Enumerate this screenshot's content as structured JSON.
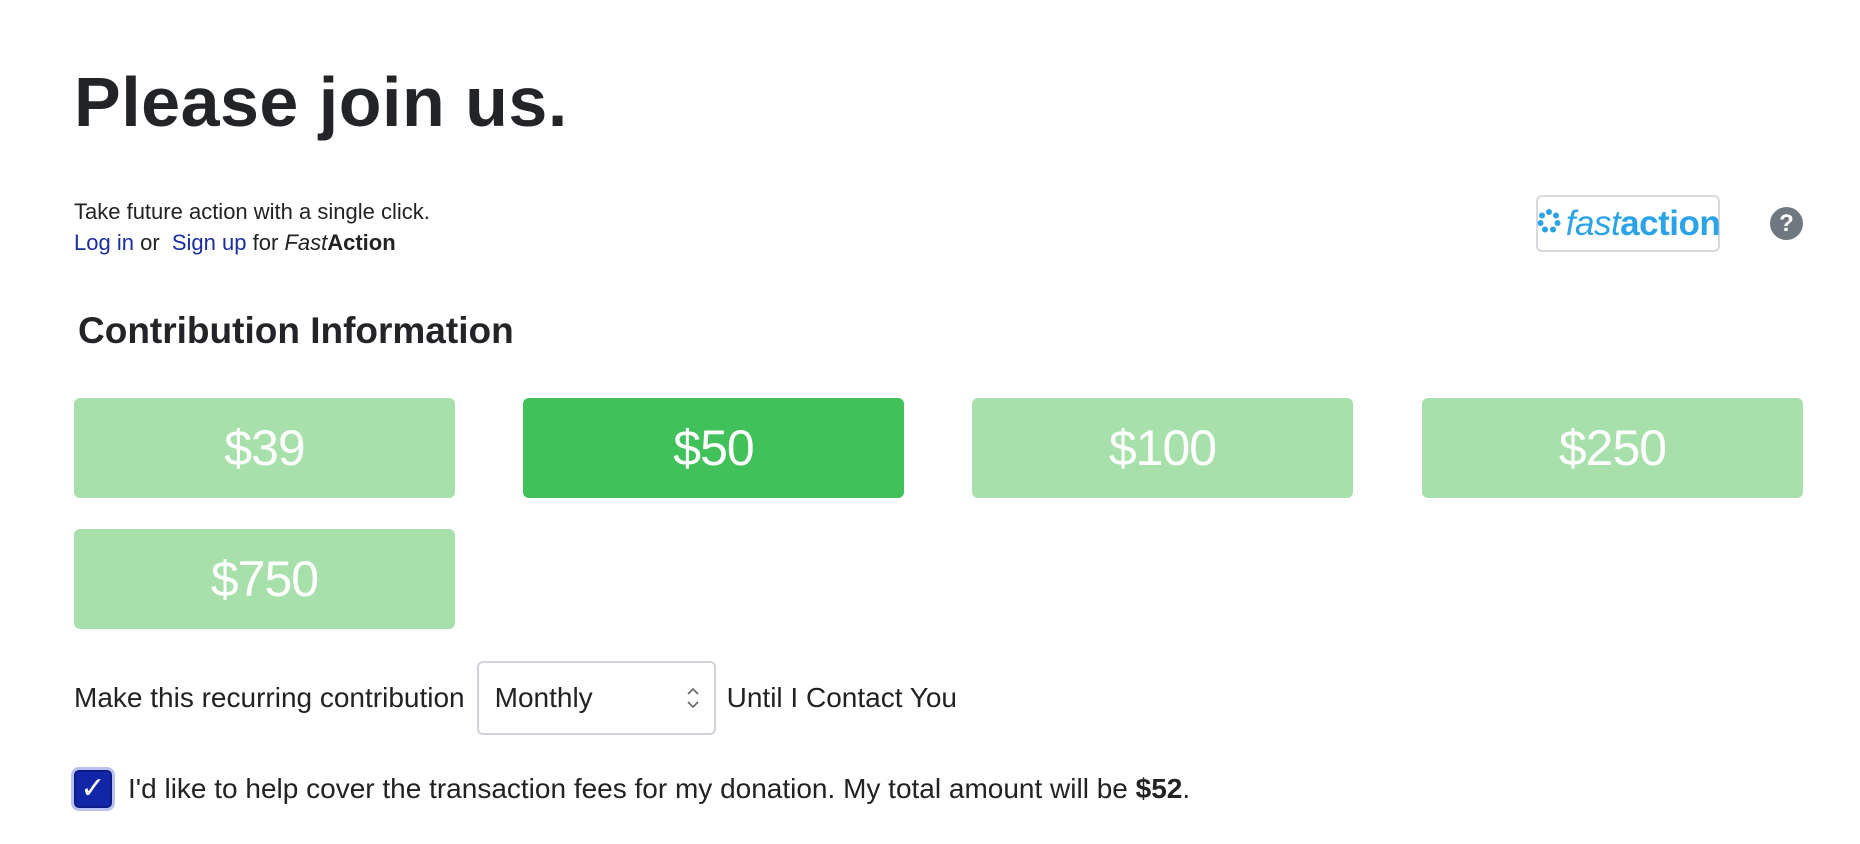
{
  "header": {
    "title": "Please join us."
  },
  "fastaction": {
    "tagline": "Take future action with a single click.",
    "login_link": "Log in",
    "or_text": "or",
    "signup_link": "Sign up",
    "for_text": "for",
    "brand_fast": "Fast",
    "brand_action": "Action",
    "logo_fast": "fast",
    "logo_action": "action",
    "help_label": "?"
  },
  "contribution": {
    "heading": "Contribution Information",
    "amounts": [
      "$39",
      "$50",
      "$100",
      "$250",
      "$750"
    ],
    "selected_amount": "$50",
    "recurring_label": "Make this recurring contribution",
    "frequency_value": "Monthly",
    "until_label": "Until I Contact You",
    "fees_text": "I'd like to help cover the transaction fees for my donation. My total amount will be",
    "fees_total": "$52",
    "fees_period": ".",
    "fees_checked": true
  },
  "colors": {
    "selected_amount_bg": "#41c15a",
    "amount_bg": "#a8e0ab",
    "link": "#1a2ea0",
    "checkbox": "#1226a8",
    "fastaction_brand": "#2aa3e8"
  }
}
